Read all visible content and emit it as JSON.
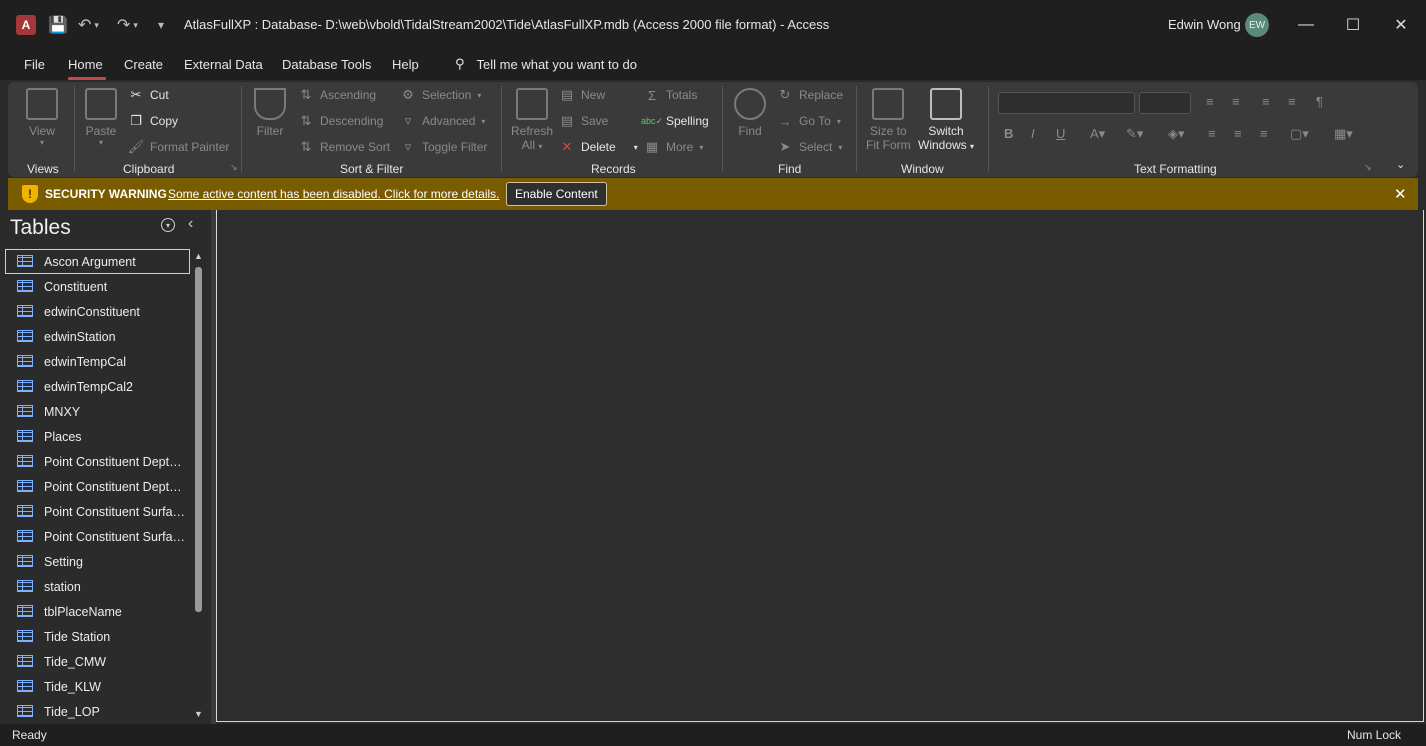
{
  "window": {
    "title": "AtlasFullXP : Database- D:\\web\\vbold\\TidalStream2002\\Tide\\AtlasFullXP.mdb (Access 2000 file format)  -  Access",
    "app_icon_letter": "A",
    "user_name": "Edwin Wong",
    "user_initials": "EW"
  },
  "tabs": [
    {
      "label": "File"
    },
    {
      "label": "Home"
    },
    {
      "label": "Create"
    },
    {
      "label": "External Data"
    },
    {
      "label": "Database Tools"
    },
    {
      "label": "Help"
    }
  ],
  "tellme": "Tell me what you want to do",
  "ribbon": {
    "views": {
      "label": "Views",
      "view": "View"
    },
    "clipboard": {
      "label": "Clipboard",
      "paste": "Paste",
      "cut": "Cut",
      "copy": "Copy",
      "format_painter": "Format Painter"
    },
    "sort_filter": {
      "label": "Sort & Filter",
      "filter": "Filter",
      "ascending": "Ascending",
      "descending": "Descending",
      "remove_sort": "Remove Sort",
      "selection": "Selection",
      "advanced": "Advanced",
      "toggle_filter": "Toggle Filter"
    },
    "records": {
      "label": "Records",
      "refresh": "Refresh",
      "refresh_all": "All",
      "new": "New",
      "save": "Save",
      "delete": "Delete",
      "totals": "Totals",
      "spelling": "Spelling",
      "more": "More"
    },
    "find": {
      "label": "Find",
      "find": "Find",
      "replace": "Replace",
      "goto": "Go To",
      "select": "Select"
    },
    "window": {
      "label": "Window",
      "size_to_fit": "Size to",
      "size_to_fit2": "Fit Form",
      "switch": "Switch",
      "switch2": "Windows"
    },
    "text_formatting": {
      "label": "Text Formatting",
      "bold": "B",
      "italic": "I",
      "underline": "U"
    }
  },
  "security": {
    "title": "SECURITY WARNING",
    "message": "Some active content has been disabled. Click for more details.",
    "button": "Enable Content"
  },
  "nav": {
    "title": "Tables",
    "items": [
      {
        "label": "Ascon Argument"
      },
      {
        "label": "Constituent"
      },
      {
        "label": "edwinConstituent"
      },
      {
        "label": "edwinStation"
      },
      {
        "label": "edwinTempCal"
      },
      {
        "label": "edwinTempCal2"
      },
      {
        "label": "MNXY"
      },
      {
        "label": "Places"
      },
      {
        "label": "Point Constituent Depth..."
      },
      {
        "label": "Point Constituent Depth..."
      },
      {
        "label": "Point Constituent Surfac..."
      },
      {
        "label": "Point Constituent Surfac..."
      },
      {
        "label": "Setting"
      },
      {
        "label": "station"
      },
      {
        "label": "tblPlaceName"
      },
      {
        "label": "Tide Station"
      },
      {
        "label": "Tide_CMW"
      },
      {
        "label": "Tide_KLW"
      },
      {
        "label": "Tide_LOP"
      }
    ]
  },
  "status": {
    "left": "Ready",
    "right": "Num Lock"
  },
  "colors": {
    "accent": "#c14a4e",
    "security_bar": "#7a5c00"
  }
}
